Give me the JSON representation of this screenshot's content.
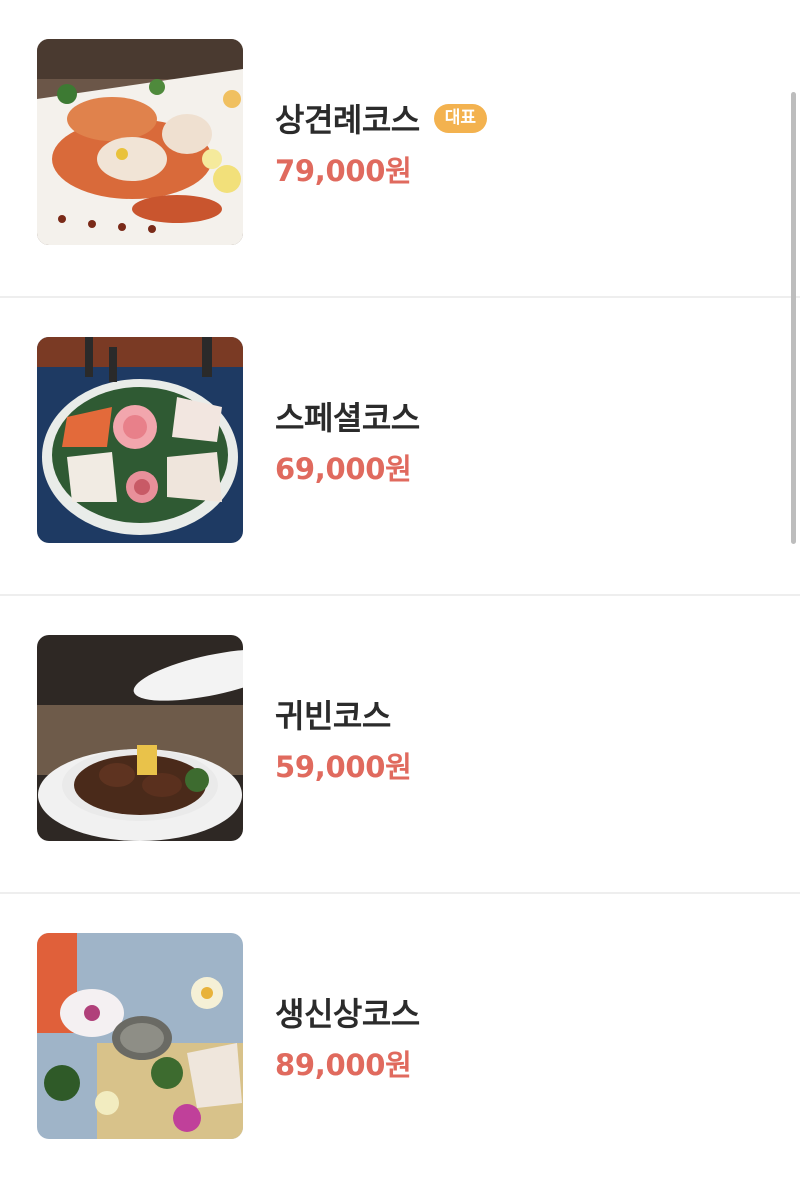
{
  "menu": {
    "items": [
      {
        "name": "상견례코스",
        "badge": "대표",
        "price": "79,000원",
        "image_icon": "shrimp-dish-photo"
      },
      {
        "name": "스페셜코스",
        "price": "69,000원",
        "image_icon": "sashimi-platter-photo"
      },
      {
        "name": "귀빈코스",
        "price": "59,000원",
        "image_icon": "braised-dish-photo"
      },
      {
        "name": "생신상코스",
        "price": "89,000원",
        "image_icon": "seafood-platter-photo"
      }
    ]
  },
  "colors": {
    "price": "#e06a5e",
    "badge_bg": "#f3b24f",
    "name": "#2b2b2b",
    "divider": "#eeeeee"
  }
}
